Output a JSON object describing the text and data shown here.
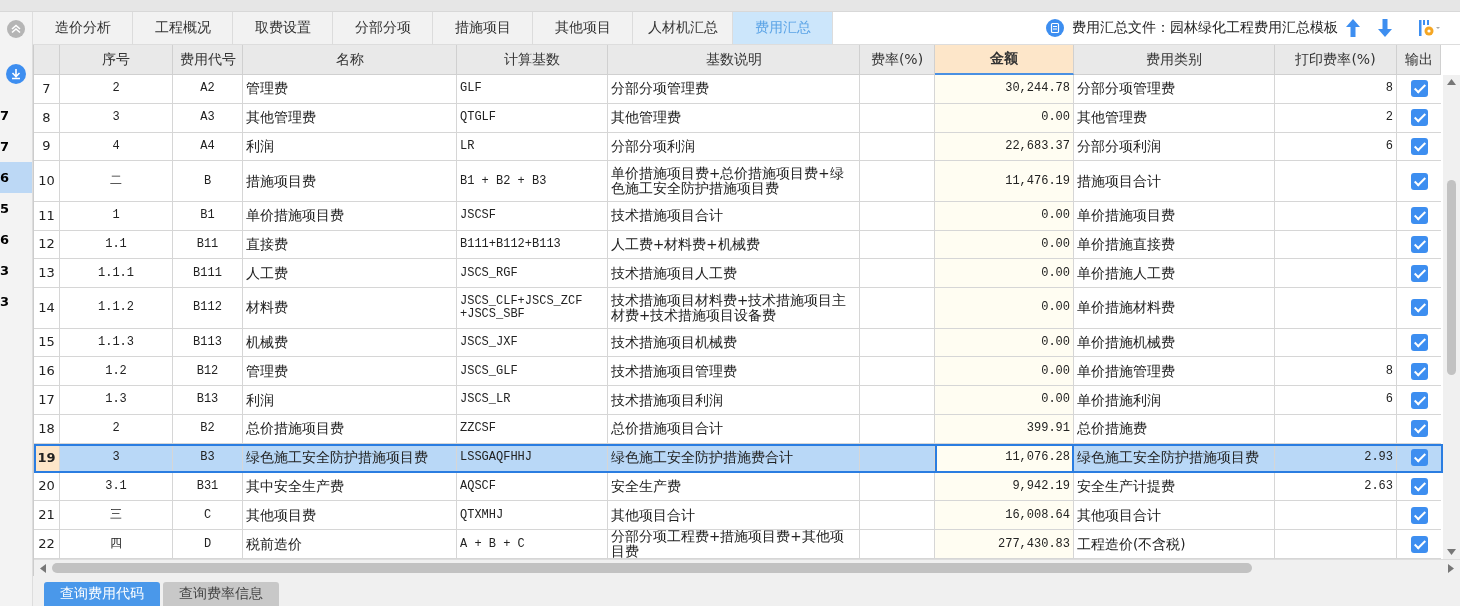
{
  "tabs": [
    {
      "label": "造价分析",
      "selected": false
    },
    {
      "label": "工程概况",
      "selected": false
    },
    {
      "label": "取费设置",
      "selected": false
    },
    {
      "label": "分部分项",
      "selected": false
    },
    {
      "label": "措施项目",
      "selected": false
    },
    {
      "label": "其他项目",
      "selected": false
    },
    {
      "label": "人材机汇总",
      "selected": false
    },
    {
      "label": "费用汇总",
      "selected": true
    }
  ],
  "template": {
    "label": "费用汇总文件：园林绿化工程费用汇总模板"
  },
  "side_panel": {
    "values": [
      {
        "text": "7",
        "selected": false
      },
      {
        "text": "7",
        "selected": false
      },
      {
        "text": "6",
        "selected": true
      },
      {
        "text": "5",
        "selected": false
      },
      {
        "text": "6",
        "selected": false
      },
      {
        "text": "3",
        "selected": false
      },
      {
        "text": "3",
        "selected": false
      }
    ]
  },
  "table": {
    "columns": [
      "序号",
      "费用代号",
      "名称",
      "计算基数",
      "基数说明",
      "费率(%)",
      "金额",
      "费用类别",
      "打印费率(%)",
      "输出"
    ],
    "rows": [
      {
        "num": "7",
        "seq": "2",
        "code": "A2",
        "name": "管理费",
        "base": "GLF",
        "desc": "分部分项管理费",
        "amount": "30,244.78",
        "category": "分部分项管理费",
        "print_rate": "8",
        "output": true,
        "selected": false
      },
      {
        "num": "8",
        "seq": "3",
        "code": "A3",
        "name": "其他管理费",
        "base": "QTGLF",
        "desc": "其他管理费",
        "amount": "0.00",
        "category": "其他管理费",
        "print_rate": "2",
        "output": true,
        "selected": false
      },
      {
        "num": "9",
        "seq": "4",
        "code": "A4",
        "name": "利润",
        "base": "LR",
        "desc": "分部分项利润",
        "amount": "22,683.37",
        "category": "分部分项利润",
        "print_rate": "6",
        "output": true,
        "selected": false
      },
      {
        "num": "10",
        "seq": "二",
        "code": "B",
        "name": "措施项目费",
        "base": "B1 + B2 + B3",
        "desc": "单价措施项目费+总价措施项目费+绿色施工安全防护措施项目费",
        "amount": "11,476.19",
        "category": "措施项目合计",
        "output": true,
        "selected": false
      },
      {
        "num": "11",
        "seq": "1",
        "code": "B1",
        "name": "单价措施项目费",
        "base": "JSCSF",
        "desc": "技术措施项目合计",
        "amount": "0.00",
        "category": "单价措施项目费",
        "output": true,
        "selected": false
      },
      {
        "num": "12",
        "seq": "1.1",
        "code": "B11",
        "name": "直接费",
        "base": "B111+B112+B113",
        "desc": "人工费+材料费+机械费",
        "amount": "0.00",
        "category": "单价措施直接费",
        "output": true,
        "selected": false
      },
      {
        "num": "13",
        "seq": "1.1.1",
        "code": "B111",
        "name": "人工费",
        "base": "JSCS_RGF",
        "desc": "技术措施项目人工费",
        "amount": "0.00",
        "category": "单价措施人工费",
        "output": true,
        "selected": false
      },
      {
        "num": "14",
        "seq": "1.1.2",
        "code": "B112",
        "name": "材料费",
        "base": "JSCS_CLF+JSCS_ZCF +JSCS_SBF",
        "desc": "技术措施项目材料费+技术措施项目主材费+技术措施项目设备费",
        "amount": "0.00",
        "category": "单价措施材料费",
        "output": true,
        "selected": false
      },
      {
        "num": "15",
        "seq": "1.1.3",
        "code": "B113",
        "name": "机械费",
        "base": "JSCS_JXF",
        "desc": "技术措施项目机械费",
        "amount": "0.00",
        "category": "单价措施机械费",
        "output": true,
        "selected": false
      },
      {
        "num": "16",
        "seq": "1.2",
        "code": "B12",
        "name": "管理费",
        "base": "JSCS_GLF",
        "desc": "技术措施项目管理费",
        "amount": "0.00",
        "category": "单价措施管理费",
        "print_rate": "8",
        "output": true,
        "selected": false
      },
      {
        "num": "17",
        "seq": "1.3",
        "code": "B13",
        "name": "利润",
        "base": "JSCS_LR",
        "desc": "技术措施项目利润",
        "amount": "0.00",
        "category": "单价措施利润",
        "print_rate": "6",
        "output": true,
        "selected": false
      },
      {
        "num": "18",
        "seq": "2",
        "code": "B2",
        "name": "总价措施项目费",
        "base": "ZZCSF",
        "desc": "总价措施项目合计",
        "amount": "399.91",
        "category": "总价措施费",
        "output": true,
        "selected": false
      },
      {
        "num": "19",
        "seq": "3",
        "code": "B3",
        "name": "绿色施工安全防护措施项目费",
        "base": "LSSGAQFHHJ",
        "desc": "绿色施工安全防护措施费合计",
        "amount": "11,076.28",
        "category": "绿色施工安全防护措施项目费",
        "print_rate": "2.93",
        "output": true,
        "selected": true
      },
      {
        "num": "20",
        "seq": "3.1",
        "code": "B31",
        "name": "其中安全生产费",
        "base": "AQSCF",
        "desc": "安全生产费",
        "amount": "9,942.19",
        "category": "安全生产计提费",
        "print_rate": "2.63",
        "output": true,
        "selected": false
      },
      {
        "num": "21",
        "seq": "三",
        "code": "C",
        "name": "其他项目费",
        "base": "QTXMHJ",
        "desc": "其他项目合计",
        "amount": "16,008.64",
        "category": "其他项目合计",
        "output": true,
        "selected": false
      },
      {
        "num": "22",
        "seq": "四",
        "code": "D",
        "name": "税前造价",
        "base": "A + B + C",
        "desc": "分部分项工程费+措施项目费+其他项目费",
        "amount": "277,430.83",
        "category": "工程造价(不含税)",
        "output": true,
        "selected": false
      }
    ]
  },
  "bottom_buttons": [
    {
      "label": "查询费用代码",
      "selected": true
    },
    {
      "label": "查询费率信息",
      "selected": false
    }
  ]
}
